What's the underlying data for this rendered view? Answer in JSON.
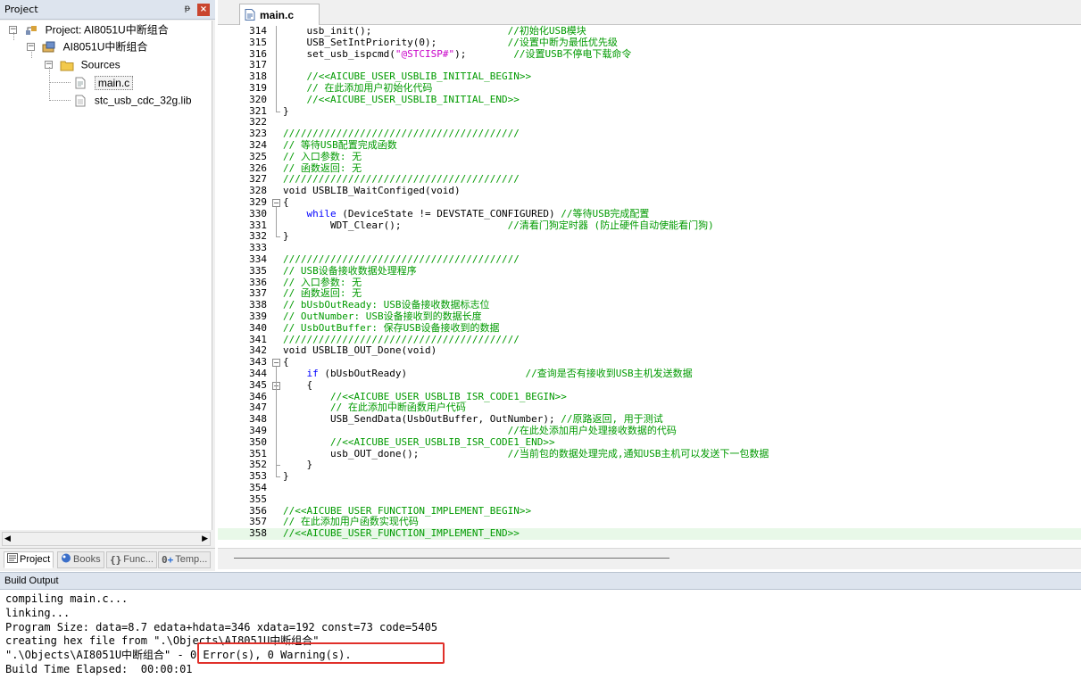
{
  "project_panel": {
    "title": "Project",
    "pin_glyph": "ᵽ",
    "close_glyph": "×",
    "tree": [
      {
        "level": 0,
        "toggle": "−",
        "icon": "project-icon",
        "label": "Project: AI8051U中断组合"
      },
      {
        "level": 1,
        "toggle": "−",
        "icon": "target-icon",
        "label": "AI8051U中断组合"
      },
      {
        "level": 2,
        "toggle": "−",
        "icon": "folder-icon",
        "label": "Sources"
      },
      {
        "level": 3,
        "toggle": "",
        "icon": "c-file-icon",
        "label": "main.c",
        "selected": true
      },
      {
        "level": 3,
        "toggle": "",
        "icon": "lib-file-icon",
        "label": "stc_usb_cdc_32g.lib"
      }
    ],
    "tabs": [
      {
        "label": "Project",
        "icon": "project-tab-icon",
        "active": true
      },
      {
        "label": "Books",
        "icon": "books-icon",
        "active": false
      },
      {
        "label": "Func...",
        "icon": "functions-icon",
        "active": false
      },
      {
        "label": "Temp...",
        "icon": "templates-icon",
        "active": false
      }
    ]
  },
  "editor": {
    "tab_label": "main.c",
    "lines": [
      {
        "n": "314",
        "code": [
          [
            "    usb_init();                       ",
            "blk"
          ],
          [
            "//初始化USB模块",
            "green"
          ]
        ]
      },
      {
        "n": "315",
        "code": [
          [
            "    USB_SetIntPriority(0);            ",
            "blk"
          ],
          [
            "//设置中断为最低优先级",
            "green"
          ]
        ]
      },
      {
        "n": "316",
        "code": [
          [
            "    set_usb_ispcmd(",
            "blk"
          ],
          [
            "\"@STCISP#\"",
            "pink"
          ],
          [
            ");        ",
            "blk"
          ],
          [
            "//设置USB不停电下载命令",
            "green"
          ]
        ]
      },
      {
        "n": "317",
        "code": []
      },
      {
        "n": "318",
        "code": [
          [
            "    //<<AICUBE_USER_USBLIB_INITIAL_BEGIN>>",
            "green"
          ]
        ]
      },
      {
        "n": "319",
        "code": [
          [
            "    // 在此添加用户初始化代码",
            "green"
          ]
        ]
      },
      {
        "n": "320",
        "code": [
          [
            "    //<<AICUBE_USER_USBLIB_INITIAL_END>>",
            "green"
          ]
        ]
      },
      {
        "n": "321",
        "code": [
          [
            "}",
            "blk"
          ]
        ]
      },
      {
        "n": "322",
        "code": []
      },
      {
        "n": "323",
        "code": [
          [
            "////////////////////////////////////////",
            "green"
          ]
        ]
      },
      {
        "n": "324",
        "code": [
          [
            "// 等待USB配置完成函数",
            "green"
          ]
        ]
      },
      {
        "n": "325",
        "code": [
          [
            "// 入口参数: 无",
            "green"
          ]
        ]
      },
      {
        "n": "326",
        "code": [
          [
            "// 函数返回: 无",
            "green"
          ]
        ]
      },
      {
        "n": "327",
        "code": [
          [
            "////////////////////////////////////////",
            "green"
          ]
        ]
      },
      {
        "n": "328",
        "code": [
          [
            "void USBLIB_WaitConfiged(void)",
            "blk"
          ]
        ]
      },
      {
        "n": "329",
        "code": [
          [
            "{",
            "blk"
          ]
        ]
      },
      {
        "n": "330",
        "code": [
          [
            "    ",
            "blk"
          ],
          [
            "while",
            "blue"
          ],
          [
            " (DeviceState != DEVSTATE_CONFIGURED) ",
            "blk"
          ],
          [
            "//等待USB完成配置",
            "green"
          ]
        ]
      },
      {
        "n": "331",
        "code": [
          [
            "        WDT_Clear();                  ",
            "blk"
          ],
          [
            "//清看门狗定时器 (防止硬件自动使能看门狗)",
            "green"
          ]
        ]
      },
      {
        "n": "332",
        "code": [
          [
            "}",
            "blk"
          ]
        ]
      },
      {
        "n": "333",
        "code": []
      },
      {
        "n": "334",
        "code": [
          [
            "////////////////////////////////////////",
            "green"
          ]
        ]
      },
      {
        "n": "335",
        "code": [
          [
            "// USB设备接收数据处理程序",
            "green"
          ]
        ]
      },
      {
        "n": "336",
        "code": [
          [
            "// 入口参数: 无",
            "green"
          ]
        ]
      },
      {
        "n": "337",
        "code": [
          [
            "// 函数返回: 无",
            "green"
          ]
        ]
      },
      {
        "n": "338",
        "code": [
          [
            "// bUsbOutReady: USB设备接收数据标志位",
            "green"
          ]
        ]
      },
      {
        "n": "339",
        "code": [
          [
            "// OutNumber: USB设备接收到的数据长度",
            "green"
          ]
        ]
      },
      {
        "n": "340",
        "code": [
          [
            "// UsbOutBuffer: 保存USB设备接收到的数据",
            "green"
          ]
        ]
      },
      {
        "n": "341",
        "code": [
          [
            "////////////////////////////////////////",
            "green"
          ]
        ]
      },
      {
        "n": "342",
        "code": [
          [
            "void USBLIB_OUT_Done(void)",
            "blk"
          ]
        ]
      },
      {
        "n": "343",
        "code": [
          [
            "{",
            "blk"
          ]
        ]
      },
      {
        "n": "344",
        "code": [
          [
            "    ",
            "blk"
          ],
          [
            "if",
            "blue"
          ],
          [
            " (bUsbOutReady)                    ",
            "blk"
          ],
          [
            "//查询是否有接收到USB主机发送数据",
            "green"
          ]
        ]
      },
      {
        "n": "345",
        "code": [
          [
            "    {",
            "blk"
          ]
        ]
      },
      {
        "n": "346",
        "code": [
          [
            "        //<<AICUBE_USER_USBLIB_ISR_CODE1_BEGIN>>",
            "green"
          ]
        ]
      },
      {
        "n": "347",
        "code": [
          [
            "        // 在此添加中断函数用户代码",
            "green"
          ]
        ]
      },
      {
        "n": "348",
        "code": [
          [
            "        USB_SendData(UsbOutBuffer, OutNumber); ",
            "blk"
          ],
          [
            "//原路返回, 用于测试",
            "green"
          ]
        ]
      },
      {
        "n": "349",
        "code": [
          [
            "                                      ",
            "blk"
          ],
          [
            "//在此处添加用户处理接收数据的代码",
            "green"
          ]
        ]
      },
      {
        "n": "350",
        "code": [
          [
            "        //<<AICUBE_USER_USBLIB_ISR_CODE1_END>>",
            "green"
          ]
        ]
      },
      {
        "n": "351",
        "code": [
          [
            "        usb_OUT_done();               ",
            "blk"
          ],
          [
            "//当前包的数据处理完成,通知USB主机可以发送下一包数据",
            "green"
          ]
        ]
      },
      {
        "n": "352",
        "code": [
          [
            "    }",
            "blk"
          ]
        ]
      },
      {
        "n": "353",
        "code": [
          [
            "}",
            "blk"
          ]
        ]
      },
      {
        "n": "354",
        "code": []
      },
      {
        "n": "355",
        "code": []
      },
      {
        "n": "356",
        "code": [
          [
            "//<<AICUBE_USER_FUNCTION_IMPLEMENT_BEGIN>>",
            "green"
          ]
        ]
      },
      {
        "n": "357",
        "code": [
          [
            "// 在此添加用户函数实现代码",
            "green"
          ]
        ]
      },
      {
        "n": "358",
        "code": [
          [
            "//<<AICUBE_USER_FUNCTION_IMPLEMENT_END>>",
            "green"
          ]
        ],
        "current": true
      }
    ]
  },
  "build_output": {
    "title": "Build Output",
    "lines": [
      "compiling main.c...",
      "linking...",
      "Program Size: data=8.7 edata+hdata=346 xdata=192 const=73 code=5405",
      "creating hex file from \".\\Objects\\AI8051U中断组合\"...",
      "\".\\Objects\\AI8051U中断组合\" - 0 Error(s), 0 Warning(s).",
      "Build Time Elapsed:  00:00:01"
    ]
  },
  "colors": {
    "comment": "#009a00",
    "keyword": "#0000ff",
    "string": "#c800c8",
    "error_highlight": "#e0302a"
  }
}
